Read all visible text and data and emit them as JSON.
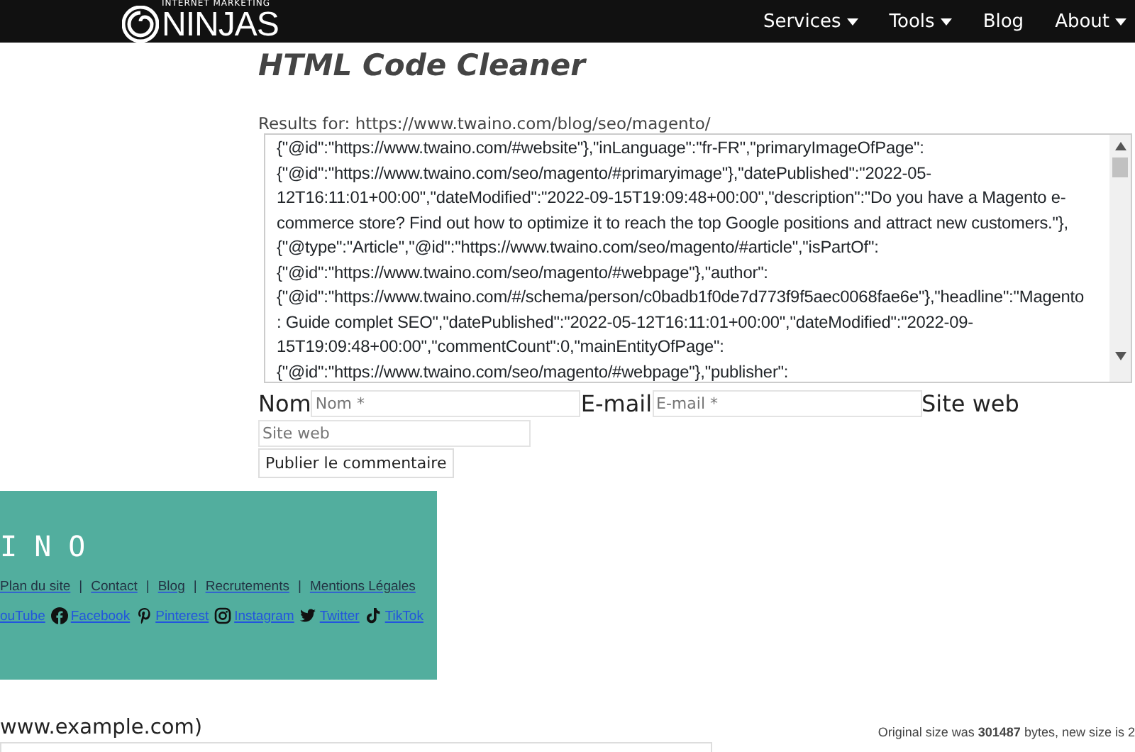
{
  "header": {
    "logo_small": "INTERNET MARKETING",
    "logo_text": "NINJAS",
    "nav": [
      {
        "label": "Services",
        "dropdown": true
      },
      {
        "label": "Tools",
        "dropdown": true
      },
      {
        "label": "Blog",
        "dropdown": false
      },
      {
        "label": "About",
        "dropdown": true
      }
    ]
  },
  "title": "HTML Code Cleaner",
  "results_label": "Results for: https://www.twaino.com/blog/seo/magento/",
  "code_lines": [
    "{\"@id\":\"https://www.twaino.com/#website\"},\"inLanguage\":\"fr-FR\",\"primaryImageOfPage\":",
    "{\"@id\":\"https://www.twaino.com/seo/magento/#primaryimage\"},\"datePublished\":\"2022-05-",
    "12T16:11:01+00:00\",\"dateModified\":\"2022-09-15T19:09:48+00:00\",\"description\":\"Do you have a Magento e-",
    "commerce store? Find out how to optimize it to reach the top Google positions and attract new customers.\"},",
    "{\"@type\":\"Article\",\"@id\":\"https://www.twaino.com/seo/magento/#article\",\"isPartOf\":",
    "{\"@id\":\"https://www.twaino.com/seo/magento/#webpage\"},\"author\":",
    "{\"@id\":\"https://www.twaino.com/#/schema/person/c0badb1f0de7d773f9f5aec0068fae6e\"},\"headline\":\"Magento",
    ": Guide complet SEO\",\"datePublished\":\"2022-05-12T16:11:01+00:00\",\"dateModified\":\"2022-09-",
    "15T19:09:48+00:00\",\"commentCount\":0,\"mainEntityOfPage\":",
    "{\"@id\":\"https://www.twaino.com/seo/magento/#webpage\"},\"publisher\":"
  ],
  "form": {
    "name_label": "Nom",
    "name_placeholder": "Nom *",
    "email_label": "E-mail",
    "email_placeholder": "E-mail *",
    "site_label": "Site web",
    "site_placeholder": "Site web",
    "submit": "Publier le commentaire"
  },
  "footer_preview": {
    "brand": "I N O",
    "separator": "|",
    "links": [
      "Plan du site",
      "Contact",
      "Blog",
      "Recrutements",
      "Mentions Légales"
    ],
    "social": [
      {
        "kind": "youtube",
        "label": "ouTube"
      },
      {
        "kind": "facebook",
        "label": "Facebook"
      },
      {
        "kind": "pinterest",
        "label": "Pinterest"
      },
      {
        "kind": "instagram",
        "label": "Instagram"
      },
      {
        "kind": "twitter",
        "label": "Twitter"
      },
      {
        "kind": "tiktok",
        "label": "TikTok"
      }
    ]
  },
  "url_hint": "www.example.com)",
  "size_info": "Original size was **301487** bytes, new size is 2"
}
